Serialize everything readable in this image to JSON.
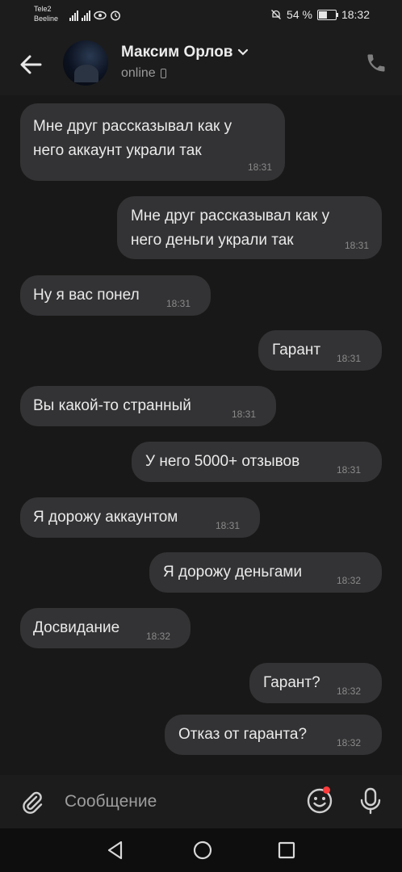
{
  "status_bar": {
    "carrier1": "Tele2",
    "carrier2": "Beeline",
    "battery_text": "54 %",
    "battery_level": 0.54,
    "time": "18:32"
  },
  "header": {
    "contact_name": "Максим Орлов",
    "presence": "online"
  },
  "messages": [
    {
      "text": "Мне друг рассказывал как у\nнего аккаунт украли так",
      "time": "18:31",
      "direction": "incoming"
    },
    {
      "text": "Мне друг рассказывал как у\nнего деньги украли так",
      "time": "18:31",
      "direction": "outgoing"
    },
    {
      "text": "Ну я вас понел",
      "time": "18:31",
      "direction": "incoming"
    },
    {
      "text": "Гарант",
      "time": "18:31",
      "direction": "outgoing"
    },
    {
      "text": "Вы какой-то странный",
      "time": "18:31",
      "direction": "incoming"
    },
    {
      "text": "У него 5000+ отзывов",
      "time": "18:31",
      "direction": "outgoing"
    },
    {
      "text": "Я дорожу аккаунтом",
      "time": "18:31",
      "direction": "incoming"
    },
    {
      "text": "Я дорожу деньгами",
      "time": "18:32",
      "direction": "outgoing"
    },
    {
      "text": "Досвидание",
      "time": "18:32",
      "direction": "incoming"
    },
    {
      "text": "Гарант?",
      "time": "18:32",
      "direction": "outgoing"
    },
    {
      "text": "Отказ от гаранта?",
      "time": "18:32",
      "direction": "outgoing"
    }
  ],
  "composer": {
    "placeholder": "Сообщение"
  },
  "icons": {
    "back": "arrow-left-icon",
    "call": "phone-icon",
    "attach": "paperclip-icon",
    "emoji": "smiley-icon",
    "mic": "microphone-icon"
  },
  "colors": {
    "background": "#181818",
    "bubble": "#333335",
    "notification_dot": "#ff3b3b"
  }
}
